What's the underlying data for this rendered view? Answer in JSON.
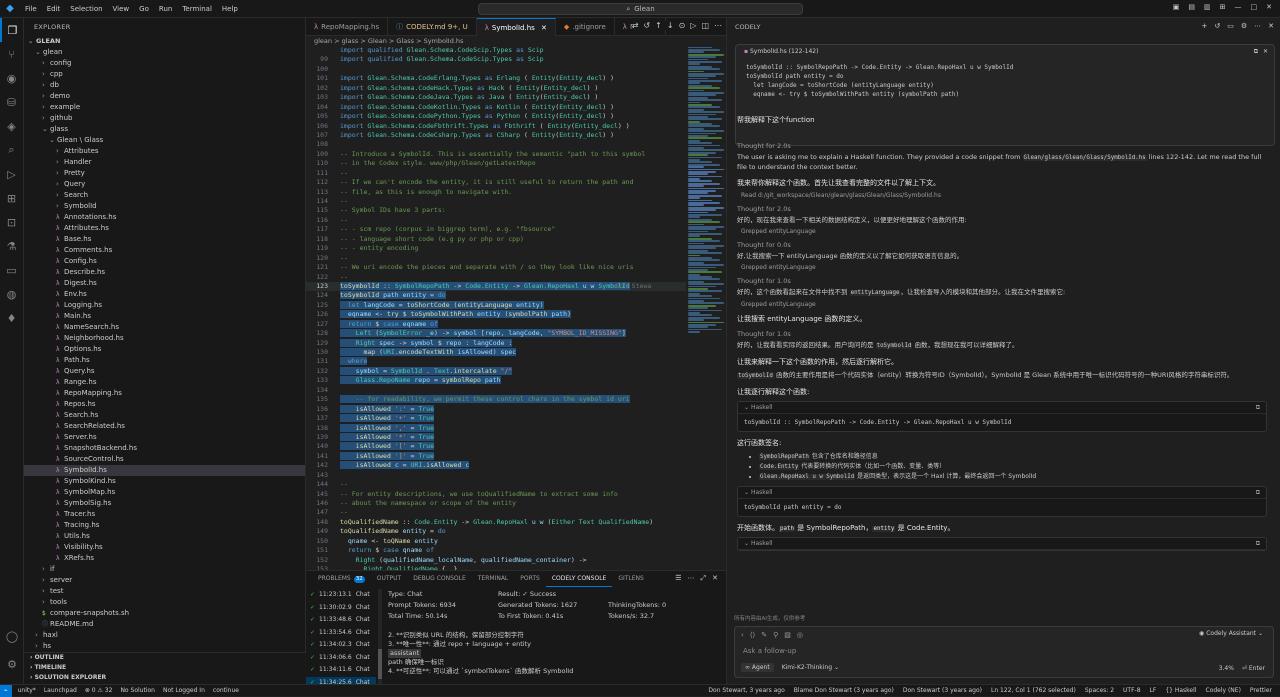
{
  "titlebar": {
    "menu": [
      "File",
      "Edit",
      "Selection",
      "View",
      "Go",
      "Run",
      "Terminal",
      "Help"
    ],
    "search": "Glean"
  },
  "explorer": {
    "header": "EXPLORER",
    "root": "GLEAN",
    "tree": [
      {
        "label": "glean",
        "depth": 1,
        "kind": "folder-open"
      },
      {
        "label": "config",
        "depth": 2,
        "kind": "folder"
      },
      {
        "label": "cpp",
        "depth": 2,
        "kind": "folder"
      },
      {
        "label": "db",
        "depth": 2,
        "kind": "folder"
      },
      {
        "label": "demo",
        "depth": 2,
        "kind": "folder"
      },
      {
        "label": "example",
        "depth": 2,
        "kind": "folder"
      },
      {
        "label": "github",
        "depth": 2,
        "kind": "folder"
      },
      {
        "label": "glass",
        "depth": 2,
        "kind": "folder-open"
      },
      {
        "label": "Glean \\ Glass",
        "depth": 3,
        "kind": "folder-open"
      },
      {
        "label": "Attributes",
        "depth": 4,
        "kind": "folder"
      },
      {
        "label": "Handler",
        "depth": 4,
        "kind": "folder"
      },
      {
        "label": "Pretty",
        "depth": 4,
        "kind": "folder"
      },
      {
        "label": "Query",
        "depth": 4,
        "kind": "folder"
      },
      {
        "label": "Search",
        "depth": 4,
        "kind": "folder"
      },
      {
        "label": "SymbolId",
        "depth": 4,
        "kind": "folder"
      },
      {
        "label": "Annotations.hs",
        "depth": 4,
        "kind": "hs"
      },
      {
        "label": "Attributes.hs",
        "depth": 4,
        "kind": "hs"
      },
      {
        "label": "Base.hs",
        "depth": 4,
        "kind": "hs"
      },
      {
        "label": "Comments.hs",
        "depth": 4,
        "kind": "hs"
      },
      {
        "label": "Config.hs",
        "depth": 4,
        "kind": "hs"
      },
      {
        "label": "Describe.hs",
        "depth": 4,
        "kind": "hs"
      },
      {
        "label": "Digest.hs",
        "depth": 4,
        "kind": "hs"
      },
      {
        "label": "Env.hs",
        "depth": 4,
        "kind": "hs"
      },
      {
        "label": "Logging.hs",
        "depth": 4,
        "kind": "hs"
      },
      {
        "label": "Main.hs",
        "depth": 4,
        "kind": "hs"
      },
      {
        "label": "NameSearch.hs",
        "depth": 4,
        "kind": "hs"
      },
      {
        "label": "Neighborhood.hs",
        "depth": 4,
        "kind": "hs"
      },
      {
        "label": "Options.hs",
        "depth": 4,
        "kind": "hs"
      },
      {
        "label": "Path.hs",
        "depth": 4,
        "kind": "hs"
      },
      {
        "label": "Query.hs",
        "depth": 4,
        "kind": "hs"
      },
      {
        "label": "Range.hs",
        "depth": 4,
        "kind": "hs"
      },
      {
        "label": "RepoMapping.hs",
        "depth": 4,
        "kind": "hs"
      },
      {
        "label": "Repos.hs",
        "depth": 4,
        "kind": "hs"
      },
      {
        "label": "Search.hs",
        "depth": 4,
        "kind": "hs"
      },
      {
        "label": "SearchRelated.hs",
        "depth": 4,
        "kind": "hs"
      },
      {
        "label": "Server.hs",
        "depth": 4,
        "kind": "hs"
      },
      {
        "label": "SnapshotBackend.hs",
        "depth": 4,
        "kind": "hs"
      },
      {
        "label": "SourceControl.hs",
        "depth": 4,
        "kind": "hs"
      },
      {
        "label": "SymbolId.hs",
        "depth": 4,
        "kind": "hs",
        "selected": true
      },
      {
        "label": "SymbolKind.hs",
        "depth": 4,
        "kind": "hs"
      },
      {
        "label": "SymbolMap.hs",
        "depth": 4,
        "kind": "hs"
      },
      {
        "label": "SymbolSig.hs",
        "depth": 4,
        "kind": "hs"
      },
      {
        "label": "Tracer.hs",
        "depth": 4,
        "kind": "hs"
      },
      {
        "label": "Tracing.hs",
        "depth": 4,
        "kind": "hs"
      },
      {
        "label": "Utils.hs",
        "depth": 4,
        "kind": "hs"
      },
      {
        "label": "Visibility.hs",
        "depth": 4,
        "kind": "hs"
      },
      {
        "label": "XRefs.hs",
        "depth": 4,
        "kind": "hs"
      },
      {
        "label": "if",
        "depth": 2,
        "kind": "folder"
      },
      {
        "label": "server",
        "depth": 2,
        "kind": "folder"
      },
      {
        "label": "test",
        "depth": 2,
        "kind": "folder"
      },
      {
        "label": "tools",
        "depth": 2,
        "kind": "folder"
      },
      {
        "label": "compare-snapshots.sh",
        "depth": 2,
        "kind": "sh"
      },
      {
        "label": "README.md",
        "depth": 2,
        "kind": "md"
      },
      {
        "label": "haxl",
        "depth": 1,
        "kind": "folder"
      },
      {
        "label": "hs",
        "depth": 1,
        "kind": "folder"
      }
    ],
    "outline": "OUTLINE",
    "timeline": "TIMELINE",
    "solution": "SOLUTION EXPLORER"
  },
  "tabs": [
    {
      "label": "RepoMapping.hs",
      "kind": "hs"
    },
    {
      "label": "CODELY.md 9+, U",
      "kind": "md",
      "mod": true
    },
    {
      "label": "SymbolId.hs",
      "kind": "hs",
      "active": true
    },
    {
      "label": ".gitignore",
      "kind": "git"
    },
    {
      "label": "Main.hs",
      "kind": "hs"
    }
  ],
  "breadcrumb": "glean > glass > Glean > Glass > SymbolId.hs",
  "code": [
    {
      "n": "",
      "t": "<span class='kw'>import qualified</span> <span class='ty'>Glean.Schema.CodeScip.Types</span> <span class='kw'>as</span> <span class='ty'>Scip</span>"
    },
    {
      "n": "99",
      "t": "<span class='kw'>import qualified</span> <span class='ty'>Glean.Schema.CodeScip.Types</span> <span class='kw'>as</span> <span class='ty'>Scip</span>"
    },
    {
      "n": "100",
      "t": ""
    },
    {
      "n": "101",
      "t": "<span class='kw'>import</span> <span class='ty'>Glean.Schema.CodeErlang.Types</span> <span class='kw'>as</span> <span class='ty'>Erlang</span> ( <span class='ty'>Entity</span>(<span class='ty'>Entity_decl</span>) )"
    },
    {
      "n": "102",
      "t": "<span class='kw'>import</span> <span class='ty'>Glean.Schema.CodeHack.Types</span> <span class='kw'>as</span> <span class='ty'>Hack</span> ( <span class='ty'>Entity</span>(<span class='ty'>Entity_decl</span>) )"
    },
    {
      "n": "103",
      "t": "<span class='kw'>import</span> <span class='ty'>Glean.Schema.CodeJava.Types</span> <span class='kw'>as</span> <span class='ty'>Java</span> ( <span class='ty'>Entity</span>(<span class='ty'>Entity_decl</span>) )"
    },
    {
      "n": "104",
      "t": "<span class='kw'>import</span> <span class='ty'>Glean.Schema.CodeKotlin.Types</span> <span class='kw'>as</span> <span class='ty'>Kotlin</span> ( <span class='ty'>Entity</span>(<span class='ty'>Entity_decl</span>) )"
    },
    {
      "n": "105",
      "t": "<span class='kw'>import</span> <span class='ty'>Glean.Schema.CodePython.Types</span> <span class='kw'>as</span> <span class='ty'>Python</span> ( <span class='ty'>Entity</span>(<span class='ty'>Entity_decl</span>) )"
    },
    {
      "n": "106",
      "t": "<span class='kw'>import</span> <span class='ty'>Glean.Schema.CodeFbthrift.Types</span> <span class='kw'>as</span> <span class='ty'>Fbthrift</span> ( <span class='ty'>Entity</span>(<span class='ty'>Entity_decl</span>) )"
    },
    {
      "n": "107",
      "t": "<span class='kw'>import</span> <span class='ty'>Glean.Schema.CodeCsharp.Types</span> <span class='kw'>as</span> <span class='ty'>CSharp</span> ( <span class='ty'>Entity</span>(<span class='ty'>Entity_decl</span>) )"
    },
    {
      "n": "108",
      "t": ""
    },
    {
      "n": "109",
      "t": "<span class='cm'>-- Introduce a SymbolId. This is essentially the semantic \"path to this symbol</span>"
    },
    {
      "n": "110",
      "t": "<span class='cm'>-- in the Codex style. www/php/Glean/getLatestRepo</span>"
    },
    {
      "n": "111",
      "t": "<span class='cm'>--</span>"
    },
    {
      "n": "112",
      "t": "<span class='cm'>-- If we can't encode the entity, it is still useful to return the path and</span>"
    },
    {
      "n": "113",
      "t": "<span class='cm'>-- file, as this is enough to navigate with.</span>"
    },
    {
      "n": "114",
      "t": "<span class='cm'>--</span>"
    },
    {
      "n": "115",
      "t": "<span class='cm'>-- Symbol IDs have 3 parts:</span>"
    },
    {
      "n": "116",
      "t": "<span class='cm'>--</span>"
    },
    {
      "n": "117",
      "t": "<span class='cm'>-- - scm repo (corpus in biggrep term), e.g. \"fbsource\"</span>"
    },
    {
      "n": "118",
      "t": "<span class='cm'>-- - language short code (e.g py or php or cpp)</span>"
    },
    {
      "n": "119",
      "t": "<span class='cm'>-- - entity encoding</span>"
    },
    {
      "n": "120",
      "t": "<span class='cm'>--</span>"
    },
    {
      "n": "121",
      "t": "<span class='cm'>-- We uri encode the pieces and separate with / so they look like nice uris</span>"
    },
    {
      "n": "122",
      "t": "<span class='cm'>--</span>"
    },
    {
      "n": "123",
      "t": "<span class='fn'>toSymbolId</span> <span class='pl'>::</span> <span class='ty'>SymbolRepoPath</span> <span class='pl'>-&gt;</span> <span class='ty'>Code.Entity</span> <span class='pl'>-&gt;</span> <span class='ty'>Glean.RepoHaxl</span> <span class='vr'>u w</span> <span class='ty'>SymbolId</span>",
      "hl": true,
      "cur": true,
      "blame": "Don Stewa"
    },
    {
      "n": "124",
      "t": "<span class='fn'>toSymbolId</span> <span class='vr'>path entity</span> <span class='pl'>=</span> <span class='kw'>do</span>",
      "hl": true
    },
    {
      "n": "125",
      "t": "  <span class='kw'>let</span> <span class='vr'>langCode</span> <span class='pl'>=</span> <span class='fn'>toShortCode</span> (<span class='fn'>entityLanguage</span> <span class='vr'>entity</span>)",
      "hl": true
    },
    {
      "n": "126",
      "t": "  <span class='vr'>eqname</span> <span class='pl'>&lt;-</span> <span class='fn'>try</span> <span class='pl'>$</span> <span class='fn'>toSymbolWithPath</span> <span class='vr'>entity</span> (<span class='fn'>symbolPath</span> <span class='vr'>path</span>)",
      "hl": true
    },
    {
      "n": "127",
      "t": "  <span class='kw'>return</span> <span class='pl'>$</span> <span class='kw'>case</span> <span class='vr'>eqname</span> <span class='kw'>of</span>",
      "hl": true
    },
    {
      "n": "128",
      "t": "    <span class='ty'>Left</span> (<span class='ty'>SymbolError</span> <span class='vr'>_e</span>) <span class='pl'>-&gt;</span> <span class='vr'>symbol</span> [<span class='vr'>repo</span>, <span class='vr'>langCode</span>, <span class='st'>\"SYMBOL_ID_MISSING\"</span>]",
      "hl": true
    },
    {
      "n": "129",
      "t": "    <span class='ty'>Right</span> <span class='vr'>spec</span> <span class='pl'>-&gt;</span> <span class='vr'>symbol</span> <span class='pl'>$</span> <span class='vr'>repo</span> <span class='pl'>:</span> <span class='vr'>langCode</span> <span class='pl'>:</span>",
      "hl": true
    },
    {
      "n": "130",
      "t": "      <span class='fn'>map</span> (<span class='ty'>URI</span>.<span class='fn'>encodeTextWith</span> <span class='vr'>isAllowed</span>) <span class='vr'>spec</span>",
      "hl": true
    },
    {
      "n": "131",
      "t": "  <span class='kw'>where</span>",
      "hl": true
    },
    {
      "n": "132",
      "t": "    <span class='vr'>symbol</span> <span class='pl'>=</span> <span class='ty'>SymbolId</span> <span class='pl'>.</span> <span class='ty'>Text</span>.<span class='fn'>intercalate</span> <span class='st'>\"/\"</span>",
      "hl": true
    },
    {
      "n": "133",
      "t": "    <span class='ty'>Glass.RepoName</span> <span class='vr'>repo</span> <span class='pl'>=</span> <span class='fn'>symbolRepo</span> <span class='vr'>path</span>",
      "hl": true
    },
    {
      "n": "134",
      "t": "",
      "hl": true
    },
    {
      "n": "135",
      "t": "    <span class='cm'>-- for readability, we permit these control chars in the symbol id uri</span>",
      "hl": true
    },
    {
      "n": "136",
      "t": "    <span class='fn'>isAllowed</span> <span class='st'>':'</span> <span class='pl'>=</span> <span class='ty'>True</span>",
      "hl": true
    },
    {
      "n": "137",
      "t": "    <span class='fn'>isAllowed</span> <span class='st'>'+'</span> <span class='pl'>=</span> <span class='ty'>True</span>",
      "hl": true
    },
    {
      "n": "138",
      "t": "    <span class='fn'>isAllowed</span> <span class='st'>','</span> <span class='pl'>=</span> <span class='ty'>True</span>",
      "hl": true
    },
    {
      "n": "139",
      "t": "    <span class='fn'>isAllowed</span> <span class='st'>'*'</span> <span class='pl'>=</span> <span class='ty'>True</span>",
      "hl": true
    },
    {
      "n": "140",
      "t": "    <span class='fn'>isAllowed</span> <span class='st'>'['</span> <span class='pl'>=</span> <span class='ty'>True</span>",
      "hl": true
    },
    {
      "n": "141",
      "t": "    <span class='fn'>isAllowed</span> <span class='st'>']'</span> <span class='pl'>=</span> <span class='ty'>True</span>",
      "hl": true
    },
    {
      "n": "142",
      "t": "    <span class='fn'>isAllowed</span> <span class='vr'>c</span> <span class='pl'>=</span> <span class='ty'>URI</span>.<span class='fn'>isAllowed</span> <span class='vr'>c</span>",
      "hl": true
    },
    {
      "n": "143",
      "t": ""
    },
    {
      "n": "144",
      "t": "<span class='cm'>--</span>"
    },
    {
      "n": "145",
      "t": "<span class='cm'>-- For entity descriptions, we use toQualifiedName to extract some info</span>"
    },
    {
      "n": "146",
      "t": "<span class='cm'>-- about the namespace or scope of the entity</span>"
    },
    {
      "n": "147",
      "t": "<span class='cm'>--</span>"
    },
    {
      "n": "148",
      "t": "<span class='fn'>toQualifiedName</span> <span class='pl'>::</span> <span class='ty'>Code.Entity</span> <span class='pl'>-&gt;</span> <span class='ty'>Glean.RepoHaxl</span> <span class='vr'>u w</span> (<span class='ty'>Either Text QualifiedName</span>)"
    },
    {
      "n": "149",
      "t": "<span class='fn'>toQualifiedName</span> <span class='vr'>entity</span> <span class='pl'>=</span> <span class='kw'>do</span>"
    },
    {
      "n": "150",
      "t": "  <span class='vr'>qname</span> <span class='pl'>&lt;-</span> <span class='fn'>toQName</span> <span class='vr'>entity</span>"
    },
    {
      "n": "151",
      "t": "  <span class='kw'>return</span> <span class='pl'>$</span> <span class='kw'>case</span> <span class='vr'>qname</span> <span class='kw'>of</span>"
    },
    {
      "n": "152",
      "t": "    <span class='ty'>Right</span> (<span class='vr'>qualifiedName_localName</span>, <span class='vr'>qualifiedName_container</span>) <span class='pl'>-&gt;</span>"
    },
    {
      "n": "153",
      "t": "      <span class='ty'>Right</span> <span class='ty'>QualifiedName</span> {..}"
    }
  ],
  "panel": {
    "tabs": [
      "PROBLEMS",
      "OUTPUT",
      "DEBUG CONSOLE",
      "TERMINAL",
      "PORTS",
      "CODELY CONSOLE",
      "GITLENS"
    ],
    "problems_count": "32",
    "active": "CODELY CONSOLE",
    "history": [
      {
        "time": "11:23:13.1",
        "type": "Chat"
      },
      {
        "time": "11:30:02.9",
        "type": "Chat"
      },
      {
        "time": "11:33:48.6",
        "type": "Chat"
      },
      {
        "time": "11:33:54.6",
        "type": "Chat"
      },
      {
        "time": "11:34:02.3",
        "type": "Chat"
      },
      {
        "time": "11:34:06.6",
        "type": "Chat"
      },
      {
        "time": "11:34:11.6",
        "type": "Chat"
      },
      {
        "time": "11:34:25.6",
        "type": "Chat",
        "selected": true
      }
    ],
    "stats": [
      [
        "Type: Chat",
        "Result: ✓ Success",
        ""
      ],
      [
        "Prompt Tokens: 6934",
        "Generated Tokens: 1627",
        "ThinkingTokens: 0"
      ],
      [
        "Total Time: 50.14s",
        "To First Token: 0.41s",
        "Tokens/s: 32.7"
      ]
    ],
    "messages": [
      "2. **识别类似 URL 的结构，保留部分控制字符",
      "3. **唯一性**: 通过 repo + language + entity",
      "assistant",
      " path 确保唯一标识",
      "4. **可逆性**: 可以通过 `symbolTokens` 函数解析 SymbolId"
    ]
  },
  "chat": {
    "header": "CODELY",
    "context_file": "SymbolId.hs (122-142)",
    "context_code": [
      "toSymbolId :: SymbolRepoPath -> Code.Entity -> Glean.RepoHaxl u w SymbolId",
      "toSymbolId path entity = do",
      "  let langCode = toShortCode (entityLanguage entity)",
      "  eqname <- try $ toSymbolWithPath entity (symbolPath path)"
    ],
    "user_question": "帮我解释下这个function",
    "thought1": "Thought for 2.0s",
    "msg1_pre": "The user is asking me to explain a Haskell function. They provided a code snippet from ",
    "msg1_code": "Glean/glass/Glean/Glass/SymbolId.hs",
    "msg1_post": " lines 122-142. Let me read the full file to understand the context better.",
    "bold1": "我来帮你解释这个函数。首先让我查看完整的文件以了解上下文。",
    "read1": "Read d:/git_workspace/Glean/glean/glass/Glean/Glass/SymbolId.hs",
    "thought2": "Thought for 2.0s",
    "msg2": "好的，现在我来查看一下相关的数据结构定义，以便更好地理解这个函数的作用:",
    "grep2": "Grepped entityLanguage",
    "thought3": "Thought for 0.0s",
    "msg3": "好,让我搜索一下 entityLanguage 函数的定义以了解它如何获取语言信息的。",
    "grep3": "Grepped entityLanguage",
    "thought4": "Thought for 1.0s",
    "msg4_pre": "好的，这个函数看起来在文件中找不到 ",
    "msg4_code": "entityLanguage",
    "msg4_post": "，让我检查导入的模块和其他部分。让我在文件里搜索它:",
    "grep4": "Grepped entityLanguage",
    "bold2": "让我搜索 entityLanguage 函数的定义。",
    "thought5": "Thought for 1.0s",
    "msg5_pre": "好的，让我看看实际的返回结果。用户询问的是 ",
    "msg5_code": "toSymbolId",
    "msg5_post": " 函数，我想现在我可以详细解释了。",
    "bold3": "让我来解释一下这个函数的作用，然后逐行解析它。",
    "msg6_code": "toSymbolId",
    "msg6_post": " 函数的主要作用是将一个代码实体（entity）转换为符号ID（SymbolId）。SymbolId 是 Glean 系统中用于唯一标识代码符号的一种URI风格的字符串标识符。",
    "bold4": "让我逐行解释这个函数:",
    "block1_lang": "Haskell",
    "block1_code": "toSymbolId :: SymbolRepoPath -> Code.Entity -> Glean.RepoHaxl u w SymbolId",
    "bold5": "这行函数签名:",
    "bullets": [
      {
        "code": "SymbolRepoPath",
        "text": " 包含了仓库名和路径信息"
      },
      {
        "code": "Code.Entity",
        "text": " 代表要转换的代码实体（比如一个函数、变量、类等）"
      },
      {
        "code": "Glean.RepoHaxl u w SymbolId",
        "text": " 是返回类型，表示这是一个 Haxl 计算，最终会返回一个 SymbolId"
      }
    ],
    "block2_lang": "Haskell",
    "block2_code": "toSymbolId path entity = do",
    "msg7_pre": "开始函数体。",
    "msg7_code1": "path",
    "msg7_mid": " 是 SymbolRepoPath，",
    "msg7_code2": "entity",
    "msg7_post": " 是 Code.Entity。",
    "block3_lang": "Haskell",
    "foot": "所有内容由AI生成，仅供参考",
    "input_placeholder": "Ask a follow-up",
    "assistant_label": "Codely Assistant",
    "agent": "Agent",
    "model": "Kimi-K2-Thinking",
    "context_pct": "3.4%",
    "send": "Enter"
  },
  "status": {
    "left": [
      "unity*",
      "Launchpad",
      "⊗ 0 ⚠ 32",
      "No Solution",
      "Not Logged In",
      "continue"
    ],
    "right": [
      "Don Stewart, 3 years ago",
      "Blame Don Stewart (3 years ago)",
      "Don Stewart (3 years ago)",
      "Ln 122, Col 1 (762 selected)",
      "Spaces: 2",
      "UTF-8",
      "LF",
      "{} Haskell",
      "Codely (NE)",
      "Prettier"
    ]
  }
}
